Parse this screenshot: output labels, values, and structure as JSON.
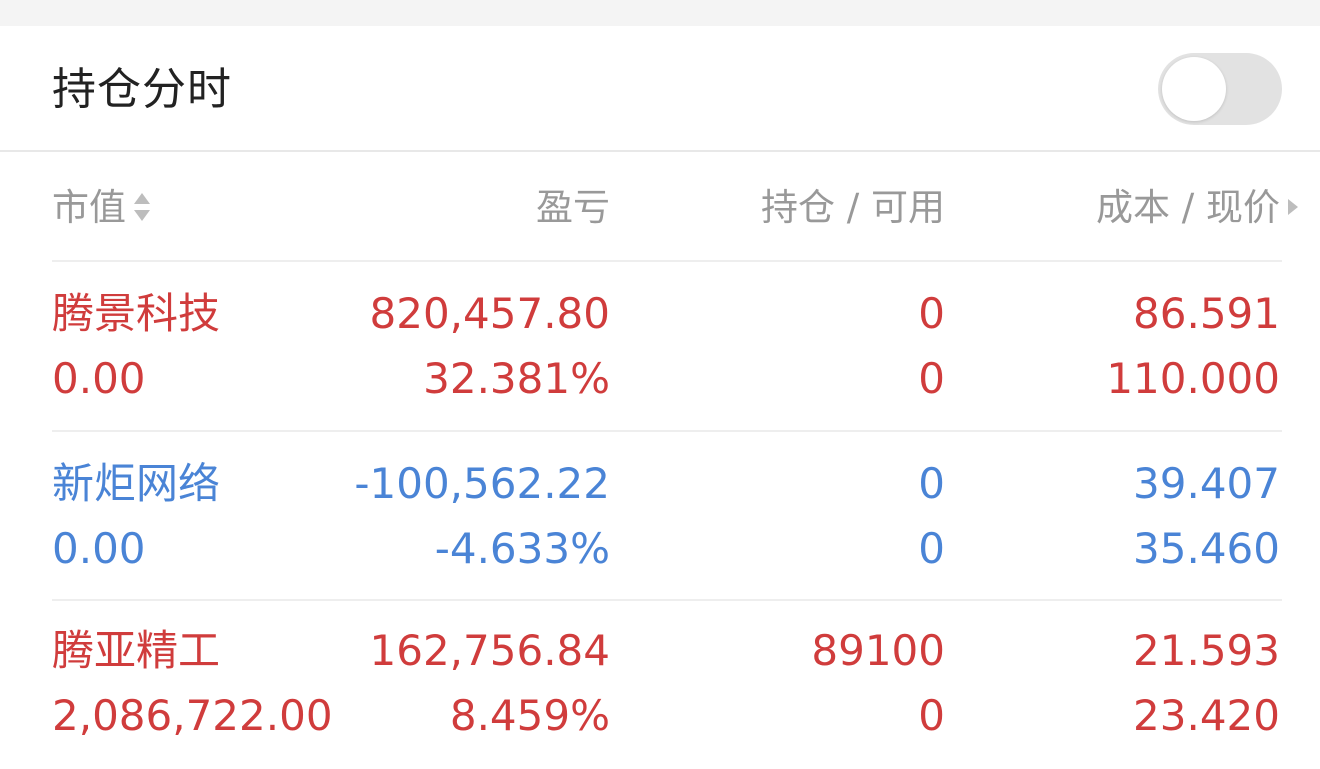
{
  "header": {
    "title": "持仓分时",
    "toggle_on": false
  },
  "columns": {
    "market_value": "市值",
    "profit_loss": "盈亏",
    "position_available": "持仓 / 可用",
    "cost_price": "成本 / 现价"
  },
  "colors": {
    "up": "#d03c3c",
    "down": "#4a84d6",
    "header_text": "#999999"
  },
  "holdings": [
    {
      "name": "腾景科技",
      "market_value": "0.00",
      "profit": "820,457.80",
      "profit_pct": "32.381%",
      "position": "0",
      "available": "0",
      "cost": "86.591",
      "price": "110.000",
      "trend": "up"
    },
    {
      "name": "新炬网络",
      "market_value": "0.00",
      "profit": "-100,562.22",
      "profit_pct": "-4.633%",
      "position": "0",
      "available": "0",
      "cost": "39.407",
      "price": "35.460",
      "trend": "down"
    },
    {
      "name": "腾亚精工",
      "market_value": "2,086,722.00",
      "profit": "162,756.84",
      "profit_pct": "8.459%",
      "position": "89100",
      "available": "0",
      "cost": "21.593",
      "price": "23.420",
      "trend": "up"
    }
  ]
}
